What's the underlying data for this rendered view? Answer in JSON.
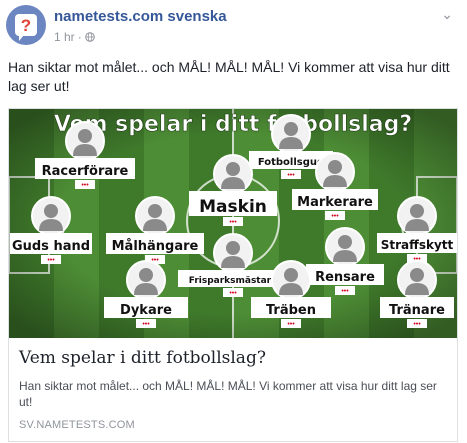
{
  "header": {
    "page_name": "nametests.com svenska",
    "time": "1 hr",
    "separator": "·"
  },
  "post": {
    "text": "Han siktar mot målet... och MÅL! MÅL! MÅL! Vi kommer att visa hur ditt lag ser ut!"
  },
  "card": {
    "image_title": "Vem spelar i ditt fotbollslag?",
    "players": [
      {
        "label": "Racerförare",
        "dots": "•••"
      },
      {
        "label": "Fotbollsgud",
        "dots": "•••"
      },
      {
        "label": "Maskin",
        "dots": "•••"
      },
      {
        "label": "Markerare",
        "dots": "•••"
      },
      {
        "label": "Guds hand",
        "dots": "•••"
      },
      {
        "label": "Målhängare",
        "dots": "•••"
      },
      {
        "label": "Straffskytt",
        "dots": "•••"
      },
      {
        "label": "Frisparksmästare",
        "dots": "•••"
      },
      {
        "label": "Rensare",
        "dots": "•••"
      },
      {
        "label": "Dykare",
        "dots": "•••"
      },
      {
        "label": "Träben",
        "dots": "•••"
      },
      {
        "label": "Tränare",
        "dots": "•••"
      }
    ],
    "title": "Vem spelar i ditt fotbollslag?",
    "description": "Han siktar mot målet... och MÅL! MÅL! MÅL! Vi kommer att visa hur ditt lag ser ut!",
    "domain": "SV.NAMETESTS.COM"
  },
  "colors": {
    "grass_dark": "#3f7a2b",
    "grass_light": "#4d8d35",
    "link_blue": "#365899"
  }
}
